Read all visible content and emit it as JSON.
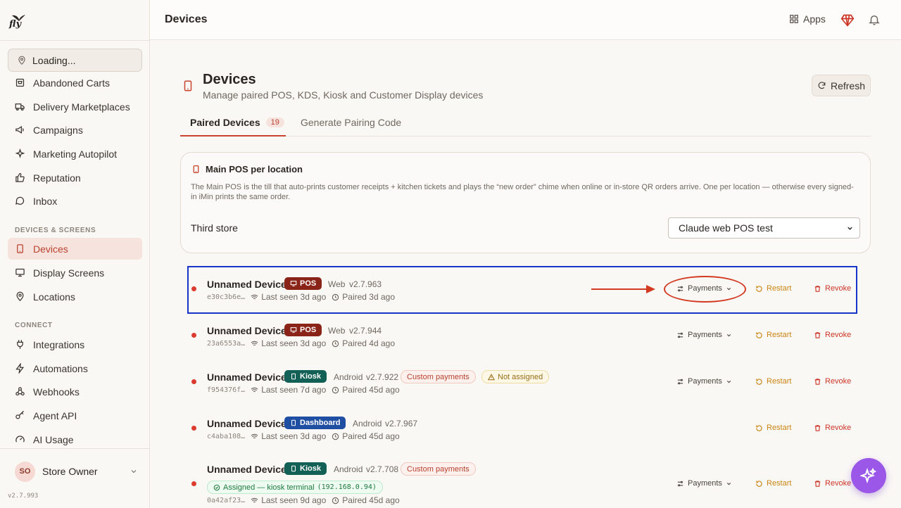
{
  "app": {
    "logo_text": "fly",
    "version": "v2.7.993"
  },
  "sidebar": {
    "location": "Loading...",
    "items_top": [
      {
        "label": "Abandoned Carts",
        "icon": "cart-icon"
      },
      {
        "label": "Delivery Marketplaces",
        "icon": "truck-icon"
      },
      {
        "label": "Campaigns",
        "icon": "megaphone-icon"
      },
      {
        "label": "Marketing Autopilot",
        "icon": "sparkle-icon"
      },
      {
        "label": "Reputation",
        "icon": "thumbs-up-icon"
      },
      {
        "label": "Inbox",
        "icon": "chat-icon"
      }
    ],
    "section_devices": "DEVICES & SCREENS",
    "items_devices": [
      {
        "label": "Devices",
        "icon": "tablet-icon",
        "active": true
      },
      {
        "label": "Display Screens",
        "icon": "monitor-icon"
      },
      {
        "label": "Locations",
        "icon": "map-pin-icon"
      }
    ],
    "section_connect": "CONNECT",
    "items_connect": [
      {
        "label": "Integrations",
        "icon": "plug-icon"
      },
      {
        "label": "Automations",
        "icon": "bolt-icon"
      },
      {
        "label": "Webhooks",
        "icon": "webhook-icon"
      },
      {
        "label": "Agent API",
        "icon": "key-icon"
      },
      {
        "label": "AI Usage",
        "icon": "gauge-icon"
      }
    ],
    "user": {
      "initials": "SO",
      "name": "Store Owner"
    }
  },
  "topbar": {
    "title": "Devices",
    "apps_label": "Apps"
  },
  "page": {
    "title": "Devices",
    "subtitle": "Manage paired POS, KDS, Kiosk and Customer Display devices",
    "refresh_label": "Refresh",
    "tabs": [
      {
        "label": "Paired Devices",
        "count": "19",
        "active": true
      },
      {
        "label": "Generate Pairing Code"
      }
    ]
  },
  "main_pos": {
    "title": "Main POS per location",
    "description": "The Main POS is the till that auto-prints customer receipts + kitchen tickets and plays the “new order” chime when online or in-store QR orders arrive. One per location — otherwise every signed-in iMin prints the same order.",
    "store_label": "Third store",
    "selected_device": "Claude web POS test"
  },
  "devices": [
    {
      "name": "Unnamed Device",
      "type": "POS",
      "platform": "Web",
      "version": "v2.7.963",
      "id": "e30c3b6e…",
      "last_seen": "Last seen 3d ago",
      "paired": "Paired 3d ago",
      "payments": "Payments",
      "restart": "Restart",
      "revoke": "Revoke"
    },
    {
      "name": "Unnamed Device",
      "type": "POS",
      "platform": "Web",
      "version": "v2.7.944",
      "id": "23a6553a…",
      "last_seen": "Last seen 3d ago",
      "paired": "Paired 4d ago",
      "payments": "Payments",
      "restart": "Restart",
      "revoke": "Revoke"
    },
    {
      "name": "Unnamed Device",
      "type": "Kiosk",
      "platform": "Android",
      "version": "v2.7.922",
      "tag1": "Custom payments",
      "tag2": "Not assigned",
      "id": "f954376f…",
      "last_seen": "Last seen 7d ago",
      "paired": "Paired 45d ago",
      "payments": "Payments",
      "restart": "Restart",
      "revoke": "Revoke"
    },
    {
      "name": "Unnamed Device",
      "type": "Dashboard",
      "platform": "Android",
      "version": "v2.7.967",
      "id": "c4aba108…",
      "last_seen": "Last seen 3d ago",
      "paired": "Paired 45d ago",
      "restart": "Restart",
      "revoke": "Revoke"
    },
    {
      "name": "Unnamed Device",
      "type": "Kiosk",
      "platform": "Android",
      "version": "v2.7.708",
      "tag1": "Custom payments",
      "assigned_prefix": "Assigned — kiosk terminal",
      "assigned_ip": "(192.168.0.94)",
      "id": "0a42af23…",
      "last_seen": "Last seen 9d ago",
      "paired": "Paired 45d ago",
      "payments": "Payments",
      "restart": "Restart",
      "revoke": "Revoke"
    }
  ],
  "colors": {
    "accent": "#c9432f",
    "pos_badge": "#8b2418",
    "kiosk_badge": "#136156",
    "dashboard_badge": "#1f4fa3",
    "highlight_box": "#1735c9",
    "annotation_red": "#d23a22",
    "fab": "#9a57e8"
  }
}
